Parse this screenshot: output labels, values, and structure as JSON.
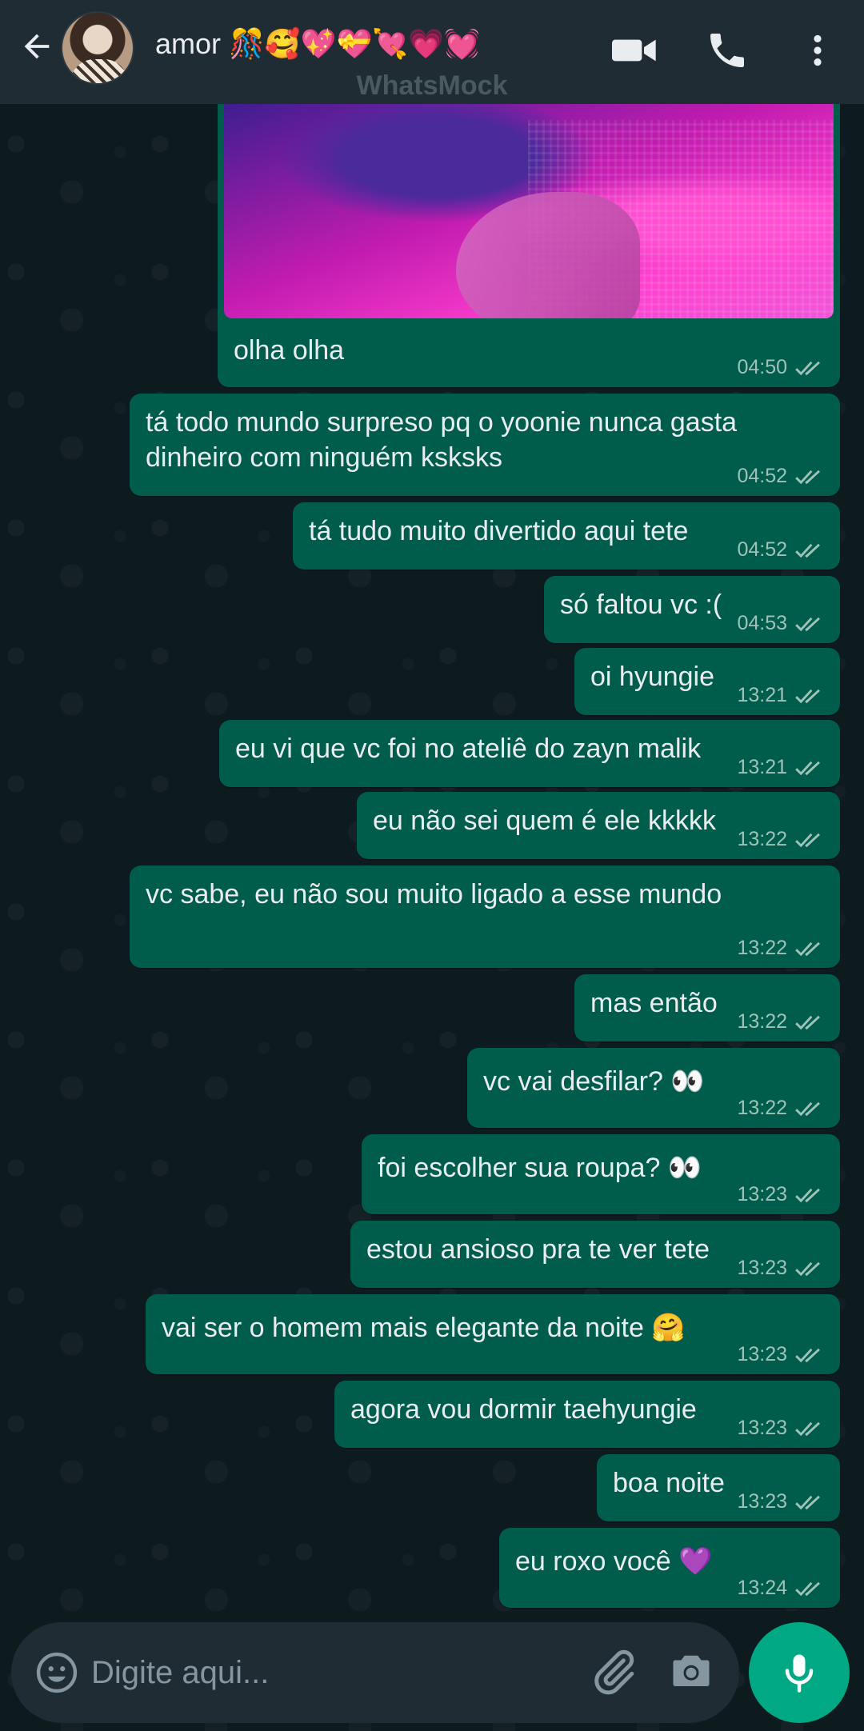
{
  "header": {
    "contact_name": "amor 🎊🥰💖💝💘💗💓",
    "watermark": "WhatsMock",
    "icons": [
      "back-arrow-icon",
      "video-camera-icon",
      "phone-icon",
      "more-vert-icon"
    ]
  },
  "messages": [
    {
      "text": "olha olha",
      "time": "04:50",
      "has_image": true
    },
    {
      "text": "tá todo mundo surpreso pq o yoonie nunca gasta dinheiro com ninguém ksksks",
      "time": "04:52"
    },
    {
      "text": "tá tudo muito divertido aqui tete",
      "time": "04:52"
    },
    {
      "text": "só faltou vc :(",
      "time": "04:53"
    },
    {
      "text": "oi hyungie",
      "time": "13:21"
    },
    {
      "text": "eu vi que vc foi no ateliê do zayn malik",
      "time": "13:21"
    },
    {
      "text": "eu não sei quem é ele kkkkk",
      "time": "13:22"
    },
    {
      "text": "vc sabe, eu não sou muito ligado a esse mundo",
      "time": "13:22"
    },
    {
      "text": "mas então",
      "time": "13:22"
    },
    {
      "text": "vc vai desfilar? 👀",
      "time": "13:22"
    },
    {
      "text": "foi escolher sua roupa? 👀",
      "time": "13:23"
    },
    {
      "text": "estou ansioso pra te ver tete",
      "time": "13:23"
    },
    {
      "text": "vai ser o homem mais elegante da noite 🤗",
      "time": "13:23"
    },
    {
      "text": "agora vou dormir taehyungie",
      "time": "13:23"
    },
    {
      "text": "boa noite",
      "time": "13:23"
    },
    {
      "text": "eu roxo você 💜",
      "time": "13:24"
    }
  ],
  "input": {
    "placeholder": "Digite aqui...",
    "value": ""
  },
  "colors": {
    "header_bg": "#1f2c33",
    "bubble_out": "#005c4b",
    "accent": "#00a884",
    "ticks": "#9fc2b8"
  }
}
